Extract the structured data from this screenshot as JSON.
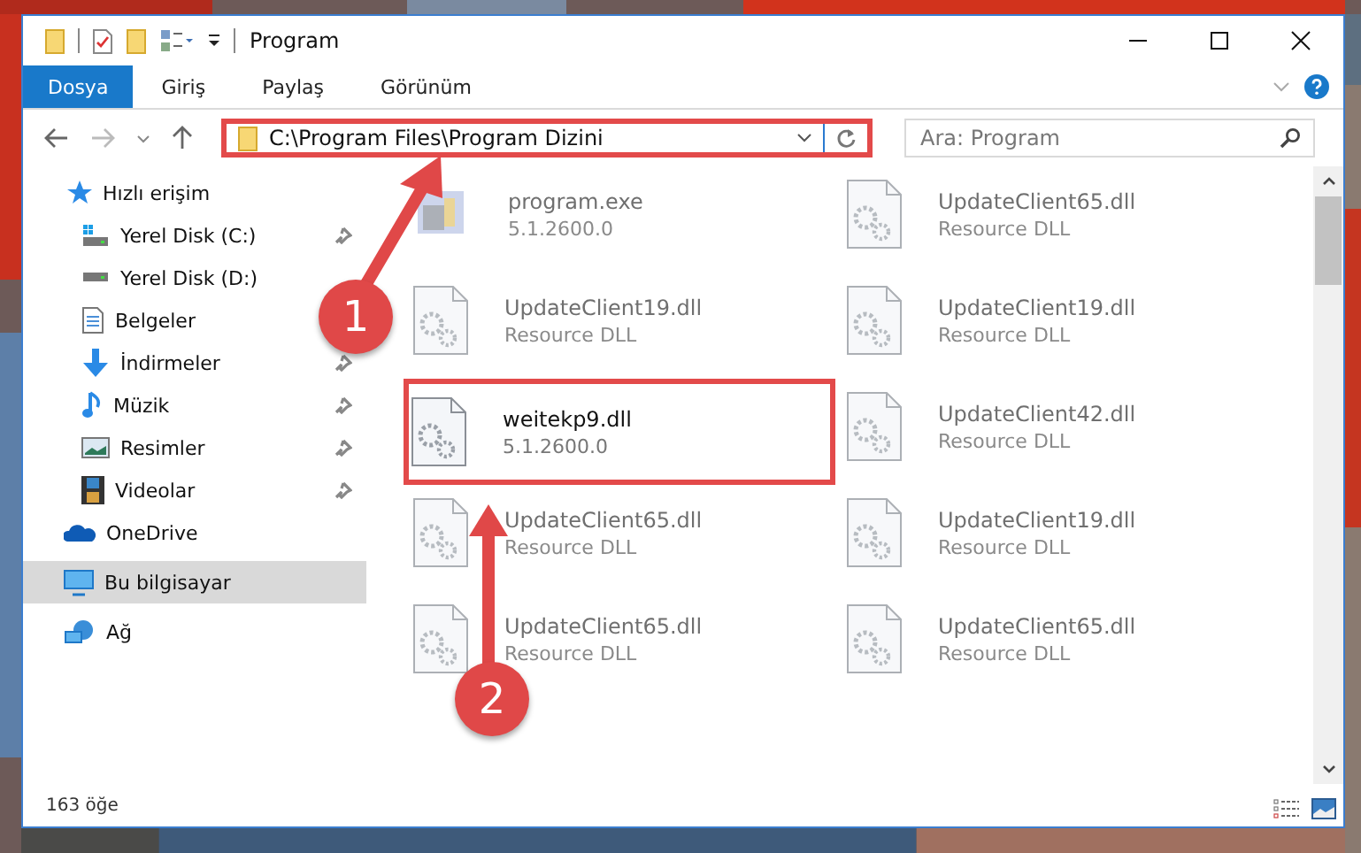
{
  "window": {
    "title": "Program"
  },
  "ribbon_tabs": [
    {
      "label": "Dosya",
      "selected": true
    },
    {
      "label": "Giriş",
      "selected": false
    },
    {
      "label": "Paylaş",
      "selected": false
    },
    {
      "label": "Görünüm",
      "selected": false
    }
  ],
  "address_bar": {
    "path": "C:\\Program Files\\Program Dizini",
    "highlighted": true
  },
  "search": {
    "placeholder": "Ara: Program"
  },
  "sidebar": {
    "items": [
      {
        "label": "Hızlı erişim",
        "selected": false,
        "children": [
          {
            "label": "Yerel Disk (C:)",
            "pinned": true,
            "selected": false
          },
          {
            "label": "Yerel Disk (D:)",
            "pinned": false,
            "selected": false
          },
          {
            "label": "Belgeler",
            "pinned": false,
            "selected": false
          },
          {
            "label": "İndirmeler",
            "pinned": true,
            "selected": false
          },
          {
            "label": "Müzik",
            "pinned": true,
            "selected": false
          },
          {
            "label": "Resimler",
            "pinned": true,
            "selected": false
          },
          {
            "label": "Videolar",
            "pinned": true,
            "selected": false
          }
        ]
      },
      {
        "label": "OneDrive",
        "selected": false
      },
      {
        "label": "Bu bilgisayar",
        "selected": true
      },
      {
        "label": "Ağ",
        "selected": false
      }
    ]
  },
  "files": [
    {
      "name": "program.exe",
      "detail": "5.1.2600.0",
      "kind": "exe",
      "blurred": true,
      "highlighted": false
    },
    {
      "name": "UpdateClient65.dll",
      "detail": "Resource DLL",
      "kind": "dll",
      "blurred": true,
      "highlighted": false
    },
    {
      "name": "UpdateClient19.dll",
      "detail": "Resource DLL",
      "kind": "dll",
      "blurred": true,
      "highlighted": false
    },
    {
      "name": "UpdateClient19.dll",
      "detail": "Resource DLL",
      "kind": "dll",
      "blurred": true,
      "highlighted": false
    },
    {
      "name": "weitekp9.dll",
      "detail": "5.1.2600.0",
      "kind": "dll",
      "blurred": false,
      "highlighted": true
    },
    {
      "name": "UpdateClient42.dll",
      "detail": "Resource DLL",
      "kind": "dll",
      "blurred": true,
      "highlighted": false
    },
    {
      "name": "UpdateClient65.dll",
      "detail": "Resource DLL",
      "kind": "dll",
      "blurred": true,
      "highlighted": false
    },
    {
      "name": "UpdateClient19.dll",
      "detail": "Resource DLL",
      "kind": "dll",
      "blurred": true,
      "highlighted": false
    },
    {
      "name": "UpdateClient65.dll",
      "detail": "Resource DLL",
      "kind": "dll",
      "blurred": true,
      "highlighted": false
    },
    {
      "name": "UpdateClient65.dll",
      "detail": "Resource DLL",
      "kind": "dll",
      "blurred": true,
      "highlighted": false
    }
  ],
  "status_bar": {
    "item_count": "163 öğe"
  },
  "annotations": [
    {
      "label": "1"
    },
    {
      "label": "2"
    }
  ]
}
